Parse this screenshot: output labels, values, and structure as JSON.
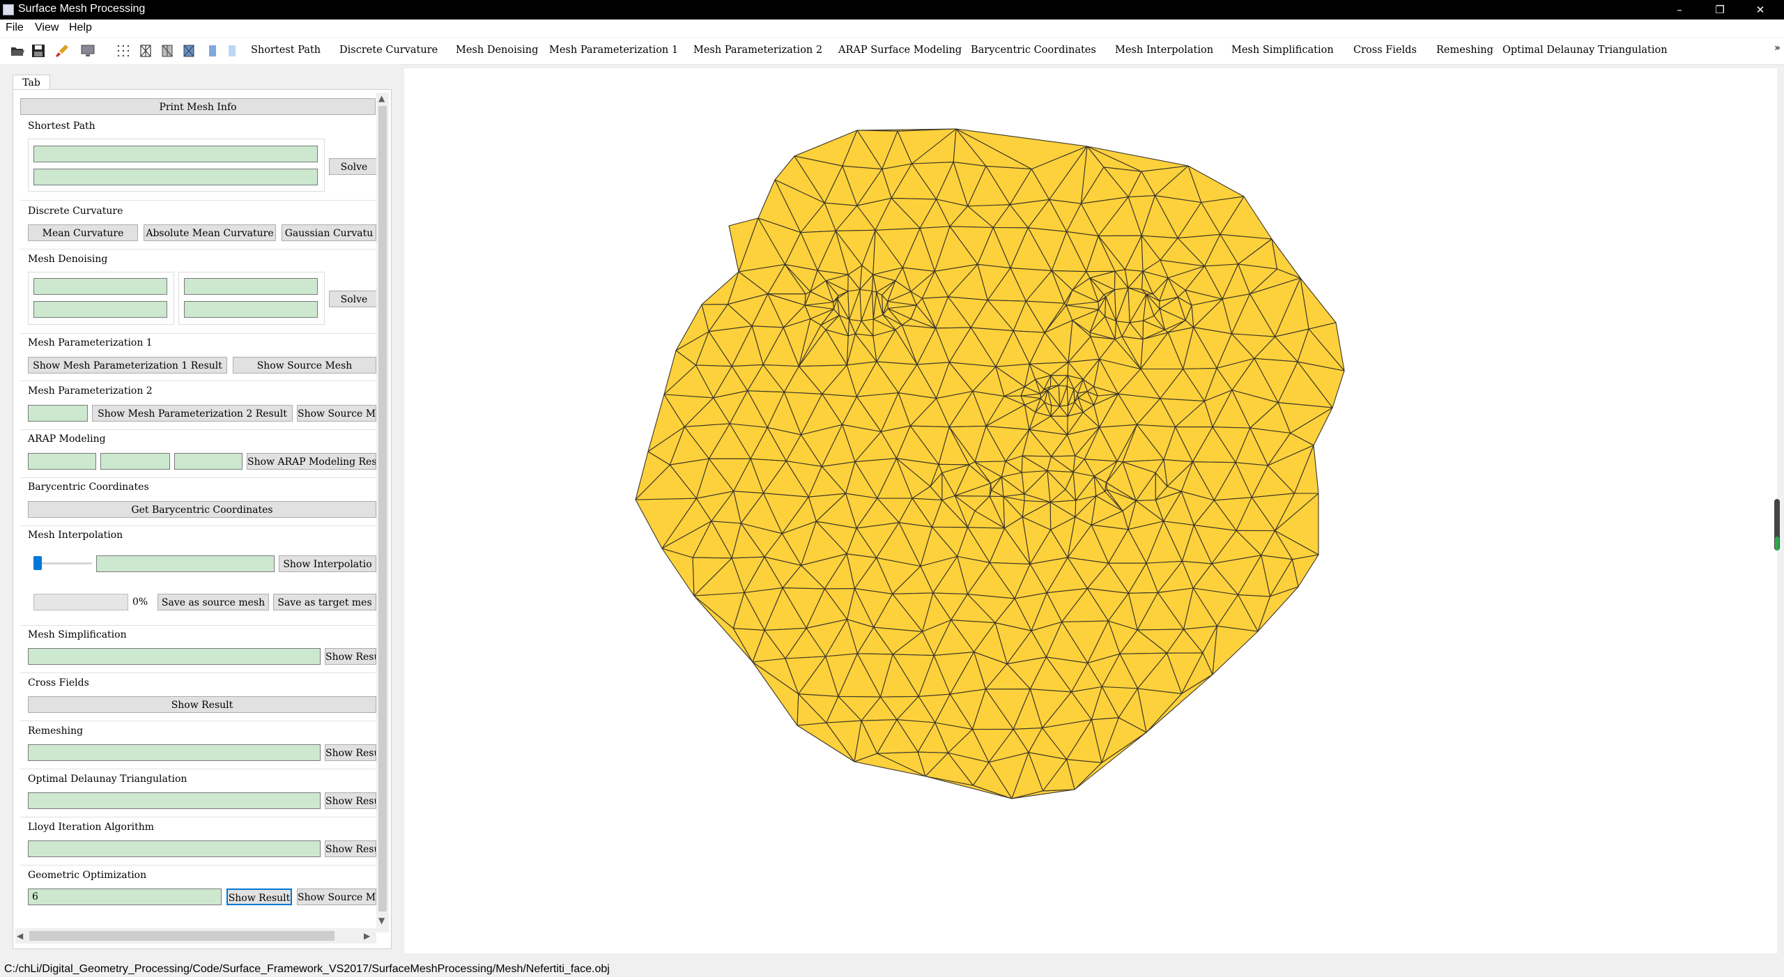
{
  "window": {
    "title": "Surface Mesh Processing",
    "minimize": "–",
    "maximize": "❐",
    "close": "✕"
  },
  "menu": [
    "File",
    "View",
    "Help"
  ],
  "toolbar": {
    "icons": [
      "open-folder-icon",
      "save-icon",
      "brush-icon",
      "display-icon",
      "mesh-points-icon",
      "wireframe-icon",
      "smooth-shading-icon",
      "flat-shading-icon",
      "light-icon",
      "material-icon"
    ],
    "labels": [
      "Shortest Path",
      "Discrete Curvature",
      "Mesh Denoising",
      "Mesh Parameterization 1",
      "Mesh Parameterization 2",
      "ARAP Surface Modeling",
      "Barycentric Coordinates",
      "Mesh Interpolation",
      "Mesh Simplification",
      "Cross Fields",
      "Remeshing",
      "Optimal Delaunay Triangulation"
    ],
    "overflow": "»"
  },
  "panel": {
    "tab": "Tab",
    "print_mesh_info": "Print Mesh Info",
    "shortest_path": {
      "title": "Shortest Path",
      "solve": "Solve"
    },
    "discrete_curvature": {
      "title": "Discrete Curvature",
      "mean": "Mean Curvature",
      "abs_mean": "Absolute Mean Curvature",
      "gaussian": "Gaussian Curvatu"
    },
    "mesh_denoising": {
      "title": "Mesh Denoising",
      "solve": "Solve"
    },
    "param1": {
      "title": "Mesh Parameterization 1",
      "show_result": "Show Mesh Parameterization 1 Result",
      "show_source": "Show Source Mesh"
    },
    "param2": {
      "title": "Mesh Parameterization 2",
      "show_result": "Show Mesh Parameterization 2 Result",
      "show_source": "Show Source Me"
    },
    "arap": {
      "title": "ARAP Modeling",
      "show_result": "Show ARAP Modeling Resu"
    },
    "barycentric": {
      "title": "Barycentric Coordinates",
      "get": "Get Barycentric Coordinates"
    },
    "interpolation": {
      "title": "Mesh Interpolation",
      "show": "Show Interpolatio",
      "percent": "0%",
      "save_source": "Save as source mesh",
      "save_target": "Save as target mes",
      "slider_value": 0
    },
    "simplification": {
      "title": "Mesh Simplification",
      "show": "Show Resu"
    },
    "cross_fields": {
      "title": "Cross Fields",
      "show": "Show Result"
    },
    "remeshing": {
      "title": "Remeshing",
      "show": "Show Resu"
    },
    "odt": {
      "title": "Optimal Delaunay Triangulation",
      "show": "Show Resu"
    },
    "lloyd": {
      "title": "Lloyd Iteration Algorithm",
      "show": "Show Resu"
    },
    "geo_opt": {
      "title": "Geometric Optimization",
      "value": "6",
      "show_result": "Show Result",
      "show_source": "Show Source Me"
    }
  },
  "mesh": {
    "fill": "#fdd13b",
    "stroke": "#3a3528"
  },
  "status": "C:/chLi/Digital_Geometry_Processing/Code/Surface_Framework_VS2017/SurfaceMeshProcessing/Mesh/Nefertiti_face.obj"
}
